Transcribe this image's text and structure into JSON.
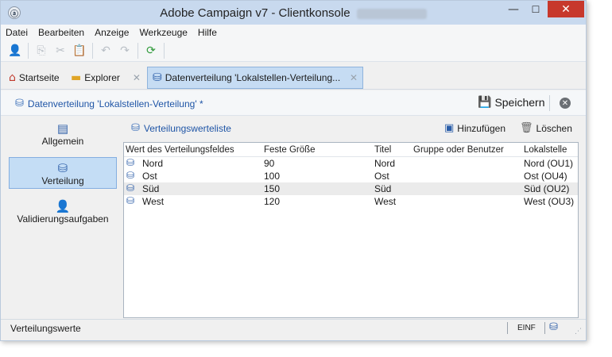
{
  "window": {
    "title": "Adobe Campaign v7 - Clientkonsole",
    "min_glyph": "—",
    "max_glyph": "☐",
    "close_glyph": "✕"
  },
  "menu": [
    "Datei",
    "Bearbeiten",
    "Anzeige",
    "Werkzeuge",
    "Hilfe"
  ],
  "tabs": {
    "home": "Startseite",
    "explorer": "Explorer",
    "active": "Datenverteilung 'Lokalstellen-Verteilung...",
    "close_glyph": "✕"
  },
  "document": {
    "title": "Datenverteilung 'Lokalstellen-Verteilung' *",
    "save_label": "Speichern"
  },
  "nav": {
    "items": [
      {
        "label": "Allgemein",
        "icon": "clipboard-icon"
      },
      {
        "label": "Verteilung",
        "icon": "database-icon",
        "selected": true
      },
      {
        "label": "Validierungsaufgaben",
        "icon": "user-task-icon"
      }
    ]
  },
  "list": {
    "title": "Verteilungswerteliste",
    "add_label": "Hinzufügen",
    "delete_label": "Löschen",
    "columns": [
      "Wert des Verteilungsfeldes",
      "Feste Größe",
      "Titel",
      "Gruppe oder Benutzer",
      "Lokalstelle"
    ],
    "rows": [
      [
        "Nord",
        "90",
        "Nord",
        "",
        "Nord (OU1)"
      ],
      [
        "Ost",
        "100",
        "Ost",
        "",
        "Ost (OU4)"
      ],
      [
        "Süd",
        "150",
        "Süd",
        "",
        "Süd (OU2)"
      ],
      [
        "West",
        "120",
        "West",
        "",
        "West (OU3)"
      ]
    ]
  },
  "status": {
    "text": "Verteilungswerte",
    "mode": "EINF"
  },
  "colors": {
    "accent": "#1f55a6",
    "selected_bg": "#c4ddf5",
    "titlebar": "#c8d9ee",
    "close_red": "#c7382c"
  }
}
